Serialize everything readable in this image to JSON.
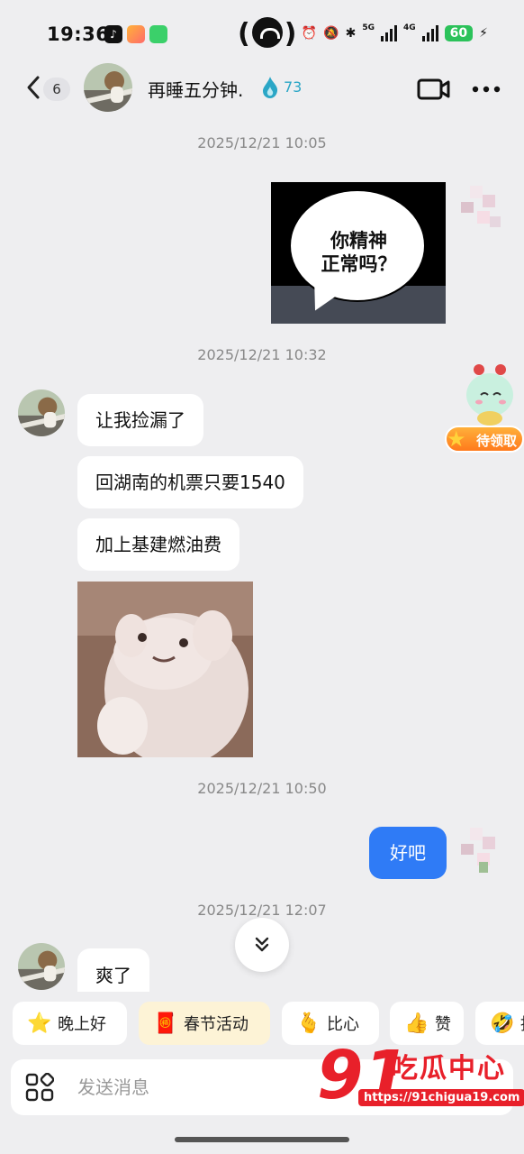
{
  "status_bar": {
    "time": "19:36",
    "battery": "60",
    "network_labels": [
      "5G",
      "4G"
    ]
  },
  "header": {
    "unread_count": "6",
    "contact_name": "再睡五分钟.",
    "spark_count": "73"
  },
  "messages": {
    "ts1": "2025/12/21 10:05",
    "meme_right_text": "你精神\n正常吗？",
    "ts2": "2025/12/21 10:32",
    "left_1": "让我捡漏了",
    "left_2": "回湖南的机票只要1540",
    "left_3": "加上基建燃油费",
    "ts3": "2025/12/21 10:50",
    "right_1": "好吧",
    "ts4": "2025/12/21 12:07",
    "left_4": "爽了"
  },
  "mascot": {
    "label": "待领取"
  },
  "quick_replies": [
    {
      "emoji": "⭐",
      "label": "晚上好"
    },
    {
      "emoji": "🧧",
      "label": "春节活动"
    },
    {
      "emoji": "🫰",
      "label": "比心"
    },
    {
      "emoji": "👍",
      "label": "赞"
    },
    {
      "emoji": "🤣",
      "label": "揺"
    }
  ],
  "input": {
    "placeholder": "发送消息"
  },
  "watermark": {
    "number": "91",
    "text": "吃瓜中心",
    "url": "https://91chigua19.com"
  },
  "colors": {
    "self_bubble": "#2f7bf6",
    "spark": "#2aa6c6",
    "watermark": "#e8202a"
  }
}
